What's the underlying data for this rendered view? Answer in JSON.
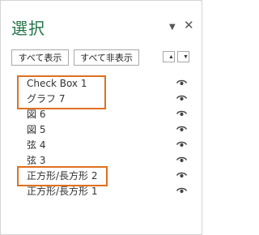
{
  "pane": {
    "title": "選択",
    "dropdown_glyph": "▼",
    "close_glyph": "✕"
  },
  "toolbar": {
    "show_all_label": "すべて表示",
    "hide_all_label": "すべて非表示",
    "move_up_glyph": "▲",
    "move_down_glyph": "▼"
  },
  "objects": [
    {
      "label": "Check Box 1",
      "visible_icon": "eye-icon",
      "highlighted": true
    },
    {
      "label": "グラフ 7",
      "visible_icon": "eye-icon",
      "highlighted": true
    },
    {
      "label": "図 6",
      "visible_icon": "eye-icon",
      "highlighted": false
    },
    {
      "label": "図 5",
      "visible_icon": "eye-icon",
      "highlighted": false
    },
    {
      "label": "弦 4",
      "visible_icon": "eye-icon",
      "highlighted": false
    },
    {
      "label": "弦 3",
      "visible_icon": "eye-icon",
      "highlighted": false
    },
    {
      "label": "正方形/長方形 2",
      "visible_icon": "eye-icon",
      "highlighted": true
    },
    {
      "label": "正方形/長方形 1",
      "visible_icon": "eye-icon",
      "highlighted": false
    }
  ],
  "colors": {
    "title": "#217346",
    "highlight": "#e0701f"
  }
}
